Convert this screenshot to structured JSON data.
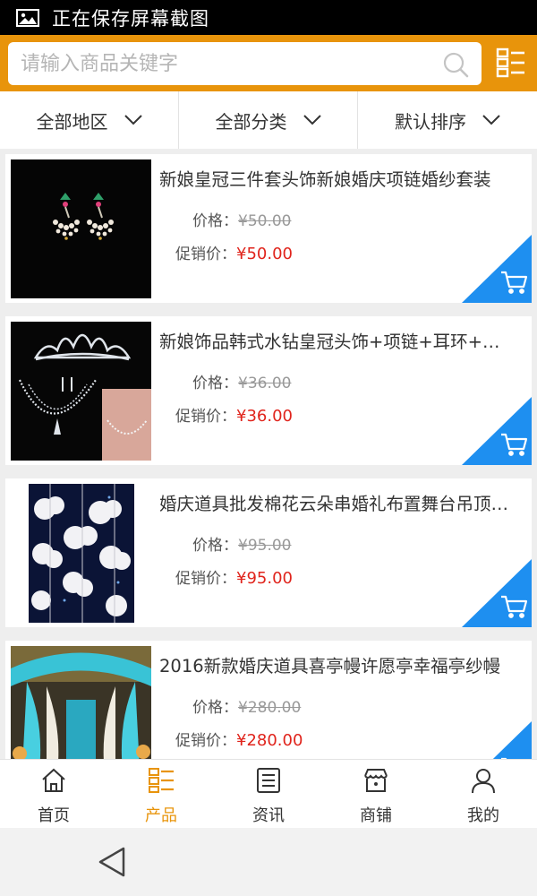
{
  "status_bar": {
    "text": "正在保存屏幕截图"
  },
  "search": {
    "placeholder": "请输入商品关键字"
  },
  "filters": [
    {
      "label": "全部地区"
    },
    {
      "label": "全部分类"
    },
    {
      "label": "默认排序"
    }
  ],
  "products": [
    {
      "title": "新娘皇冠三件套头饰新娘婚庆项链婚纱套装",
      "price_label": "价格：",
      "price": "¥50.00",
      "promo_label": "促销价：",
      "promo_price": "¥50.00",
      "image": "earrings"
    },
    {
      "title": "新娘饰品韩式水钻皇冠头饰+项链+耳环+三件套",
      "price_label": "价格：",
      "price": "¥36.00",
      "promo_label": "促销价：",
      "promo_price": "¥36.00",
      "image": "crown-necklace"
    },
    {
      "title": "婚庆道具批发棉花云朵串婚礼布置舞台吊顶装饰",
      "price_label": "价格：",
      "price": "¥95.00",
      "promo_label": "促销价：",
      "promo_price": "¥95.00",
      "image": "cotton-clouds"
    },
    {
      "title": "2016新款婚庆道具喜亭幔许愿亭幸福亭纱幔",
      "price_label": "价格：",
      "price": "¥280.00",
      "promo_label": "促销价：",
      "promo_price": "¥280.00",
      "image": "wedding-pavilion"
    }
  ],
  "bottom_nav": [
    {
      "label": "首页",
      "icon": "home-icon"
    },
    {
      "label": "产品",
      "icon": "product-list-icon",
      "active": true
    },
    {
      "label": "资讯",
      "icon": "news-icon"
    },
    {
      "label": "商铺",
      "icon": "store-icon"
    },
    {
      "label": "我的",
      "icon": "user-icon"
    }
  ],
  "colors": {
    "accent": "#e8940b",
    "cart_blue": "#1e8ff0",
    "promo_red": "#e0241c"
  }
}
